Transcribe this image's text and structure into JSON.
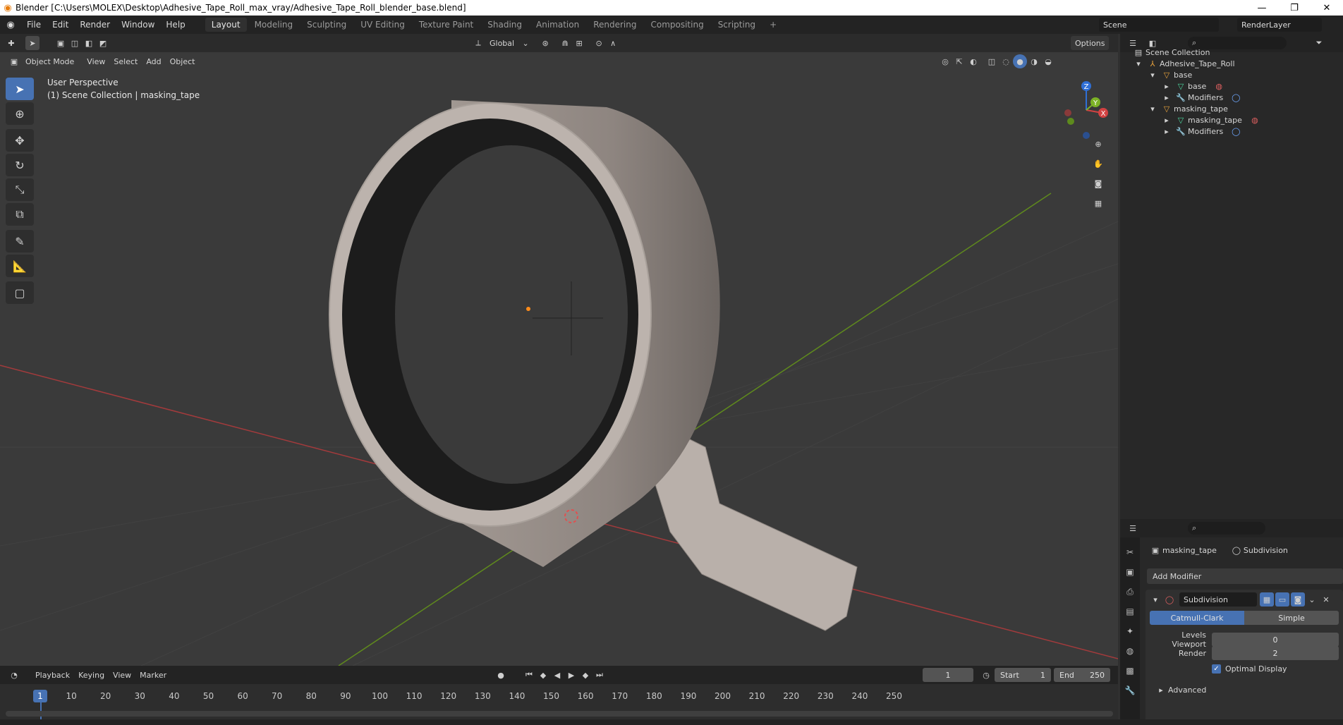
{
  "window": {
    "title": "Blender [C:\\Users\\MOLEX\\Desktop\\Adhesive_Tape_Roll_max_vray/Adhesive_Tape_Roll_blender_base.blend]",
    "controls": [
      "—",
      "❐",
      "✕"
    ]
  },
  "menubar": {
    "items": [
      "File",
      "Edit",
      "Render",
      "Window",
      "Help"
    ],
    "workspaces": [
      "Layout",
      "Modeling",
      "Sculpting",
      "UV Editing",
      "Texture Paint",
      "Shading",
      "Animation",
      "Rendering",
      "Compositing",
      "Scripting"
    ],
    "active_workspace": "Layout",
    "add_tab": "+",
    "scene": "Scene",
    "view_layer": "RenderLayer"
  },
  "viewport_header": {
    "transform_orientation": "Global",
    "options_label": "Options",
    "mode": "Object Mode",
    "menus": [
      "View",
      "Select",
      "Add",
      "Object"
    ]
  },
  "viewport": {
    "perspective_label": "User Perspective",
    "collection_label": "(1) Scene Collection | masking_tape",
    "gizmo_axes": {
      "x": "X",
      "y": "Y",
      "z": "Z"
    },
    "colors": {
      "bg": "#3b3b3b",
      "x_axis": "#c0393b",
      "y_axis": "#6a9a1f",
      "tape": "#b5aca6"
    }
  },
  "outliner": {
    "root": "Scene Collection",
    "items": [
      {
        "label": "Adhesive_Tape_Roll",
        "level": 1,
        "expanded": true
      },
      {
        "label": "base",
        "level": 2,
        "expanded": true
      },
      {
        "label": "base",
        "level": 3,
        "expanded": false
      },
      {
        "label": "Modifiers",
        "level": 3,
        "expanded": false
      },
      {
        "label": "masking_tape",
        "level": 2,
        "expanded": true
      },
      {
        "label": "masking_tape",
        "level": 3,
        "expanded": false
      },
      {
        "label": "Modifiers",
        "level": 3,
        "expanded": false
      }
    ]
  },
  "properties": {
    "object_name": "masking_tape",
    "modifier_context": "Subdivision",
    "add_modifier_label": "Add Modifier",
    "modifier_name": "Subdivision",
    "algorithm_options": [
      "Catmull-Clark",
      "Simple"
    ],
    "active_algorithm": "Catmull-Clark",
    "levels_viewport_label": "Levels Viewport",
    "levels_viewport": "0",
    "render_label": "Render",
    "render_levels": "2",
    "optimal_display_label": "Optimal Display",
    "optimal_display": true,
    "advanced_label": "Advanced"
  },
  "timeline": {
    "menus": [
      "Playback",
      "Keying",
      "View",
      "Marker"
    ],
    "current_frame": "1",
    "start_label": "Start",
    "start": "1",
    "end_label": "End",
    "end": "250",
    "ticks": [
      "10",
      "20",
      "30",
      "40",
      "50",
      "60",
      "70",
      "80",
      "90",
      "100",
      "110",
      "120",
      "130",
      "140",
      "150",
      "160",
      "170",
      "180",
      "190",
      "200",
      "210",
      "220",
      "230",
      "240",
      "250"
    ],
    "playhead": "1"
  }
}
